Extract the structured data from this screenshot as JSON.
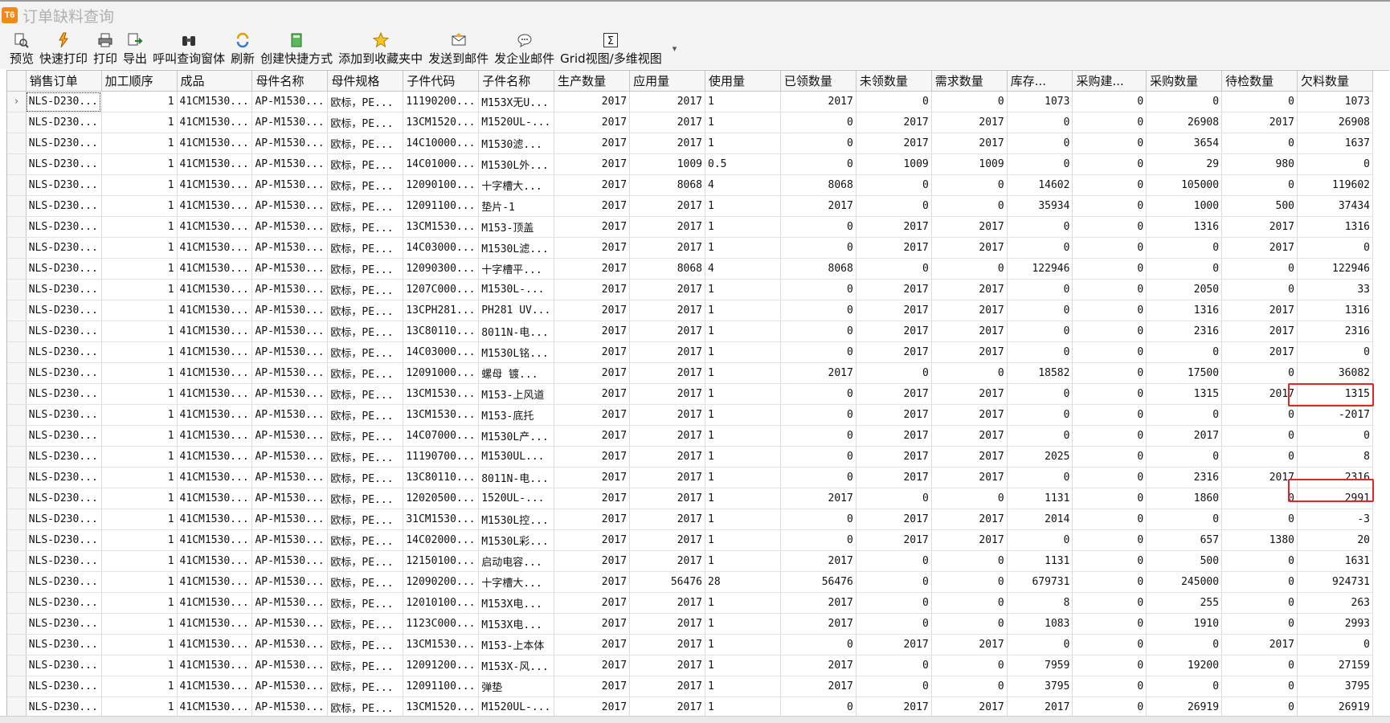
{
  "window": {
    "title": "订单缺料查询",
    "logo_text": "T6"
  },
  "toolbar": {
    "buttons": [
      {
        "label": "预览",
        "icon": "preview-icon"
      },
      {
        "label": "快速打印",
        "icon": "quick-print-icon"
      },
      {
        "label": "打印",
        "icon": "print-icon"
      },
      {
        "label": "导出",
        "icon": "export-icon"
      },
      {
        "label": "呼叫查询窗体",
        "icon": "binoculars-icon"
      },
      {
        "label": "刷新",
        "icon": "refresh-icon"
      },
      {
        "label": "创建快捷方式",
        "icon": "shortcut-icon"
      },
      {
        "label": "添加到收藏夹中",
        "icon": "star-icon"
      },
      {
        "label": "发送到邮件",
        "icon": "mail-icon"
      },
      {
        "label": "发企业邮件",
        "icon": "chat-icon"
      },
      {
        "label": "Grid视图/多维视图",
        "icon": "sigma-icon"
      }
    ],
    "more": "▾"
  },
  "grid": {
    "row_indicator": "›",
    "columns": [
      "销售订单",
      "加工顺序",
      "成品",
      "母件名称",
      "母件规格",
      "子件代码",
      "子件名称",
      "生产数量",
      "应用量",
      "使用量",
      "已领数量",
      "未领数量",
      "需求数量",
      "库存...",
      "采购建...",
      "采购数量",
      "待检数量",
      "欠料数量"
    ],
    "rows": [
      [
        "NLS-D230...",
        "1",
        "41CM1530...",
        "AP-M1530...",
        "欧标，PE...",
        "11190200...",
        "M153X无U...",
        "2017",
        "2017",
        "1",
        "2017",
        "0",
        "0",
        "1073",
        "0",
        "0",
        "0",
        "1073"
      ],
      [
        "NLS-D230...",
        "1",
        "41CM1530...",
        "AP-M1530...",
        "欧标，PE...",
        "13CM1520...",
        "M1520UL-...",
        "2017",
        "2017",
        "1",
        "0",
        "2017",
        "2017",
        "0",
        "0",
        "26908",
        "2017",
        "26908"
      ],
      [
        "NLS-D230...",
        "1",
        "41CM1530...",
        "AP-M1530...",
        "欧标，PE...",
        "14C10000...",
        "M1530滤...",
        "2017",
        "2017",
        "1",
        "0",
        "2017",
        "2017",
        "0",
        "0",
        "3654",
        "0",
        "1637"
      ],
      [
        "NLS-D230...",
        "1",
        "41CM1530...",
        "AP-M1530...",
        "欧标，PE...",
        "14C01000...",
        "M1530L外...",
        "2017",
        "1009",
        "0.5",
        "0",
        "1009",
        "1009",
        "0",
        "0",
        "29",
        "980",
        "0"
      ],
      [
        "NLS-D230...",
        "1",
        "41CM1530...",
        "AP-M1530...",
        "欧标，PE...",
        "12090100...",
        "十字槽大...",
        "2017",
        "8068",
        "4",
        "8068",
        "0",
        "0",
        "14602",
        "0",
        "105000",
        "0",
        "119602"
      ],
      [
        "NLS-D230...",
        "1",
        "41CM1530...",
        "AP-M1530...",
        "欧标，PE...",
        "12091100...",
        "垫片-1",
        "2017",
        "2017",
        "1",
        "2017",
        "0",
        "0",
        "35934",
        "0",
        "1000",
        "500",
        "37434"
      ],
      [
        "NLS-D230...",
        "1",
        "41CM1530...",
        "AP-M1530...",
        "欧标，PE...",
        "13CM1530...",
        "M153-顶盖",
        "2017",
        "2017",
        "1",
        "0",
        "2017",
        "2017",
        "0",
        "0",
        "1316",
        "2017",
        "1316"
      ],
      [
        "NLS-D230...",
        "1",
        "41CM1530...",
        "AP-M1530...",
        "欧标，PE...",
        "14C03000...",
        "M1530L滤...",
        "2017",
        "2017",
        "1",
        "0",
        "2017",
        "2017",
        "0",
        "0",
        "0",
        "2017",
        "0"
      ],
      [
        "NLS-D230...",
        "1",
        "41CM1530...",
        "AP-M1530...",
        "欧标，PE...",
        "12090300...",
        "十字槽平...",
        "2017",
        "8068",
        "4",
        "8068",
        "0",
        "0",
        "122946",
        "0",
        "0",
        "0",
        "122946"
      ],
      [
        "NLS-D230...",
        "1",
        "41CM1530...",
        "AP-M1530...",
        "欧标，PE...",
        "1207C000...",
        "M1530L-...",
        "2017",
        "2017",
        "1",
        "0",
        "2017",
        "2017",
        "0",
        "0",
        "2050",
        "0",
        "33"
      ],
      [
        "NLS-D230...",
        "1",
        "41CM1530...",
        "AP-M1530...",
        "欧标，PE...",
        "13CPH281...",
        "PH281 UV...",
        "2017",
        "2017",
        "1",
        "0",
        "2017",
        "2017",
        "0",
        "0",
        "1316",
        "2017",
        "1316"
      ],
      [
        "NLS-D230...",
        "1",
        "41CM1530...",
        "AP-M1530...",
        "欧标，PE...",
        "13C80110...",
        "8011N-电...",
        "2017",
        "2017",
        "1",
        "0",
        "2017",
        "2017",
        "0",
        "0",
        "2316",
        "2017",
        "2316"
      ],
      [
        "NLS-D230...",
        "1",
        "41CM1530...",
        "AP-M1530...",
        "欧标，PE...",
        "14C03000...",
        "M1530L铭...",
        "2017",
        "2017",
        "1",
        "0",
        "2017",
        "2017",
        "0",
        "0",
        "0",
        "2017",
        "0"
      ],
      [
        "NLS-D230...",
        "1",
        "41CM1530...",
        "AP-M1530...",
        "欧标，PE...",
        "12091000...",
        "螺母 镀...",
        "2017",
        "2017",
        "1",
        "2017",
        "0",
        "0",
        "18582",
        "0",
        "17500",
        "0",
        "36082"
      ],
      [
        "NLS-D230...",
        "1",
        "41CM1530...",
        "AP-M1530...",
        "欧标，PE...",
        "13CM1530...",
        "M153-上风道",
        "2017",
        "2017",
        "1",
        "0",
        "2017",
        "2017",
        "0",
        "0",
        "1315",
        "2017",
        "1315"
      ],
      [
        "NLS-D230...",
        "1",
        "41CM1530...",
        "AP-M1530...",
        "欧标，PE...",
        "13CM1530...",
        "M153-底托",
        "2017",
        "2017",
        "1",
        "0",
        "2017",
        "2017",
        "0",
        "0",
        "0",
        "0",
        "-2017"
      ],
      [
        "NLS-D230...",
        "1",
        "41CM1530...",
        "AP-M1530...",
        "欧标，PE...",
        "14C07000...",
        "M1530L产...",
        "2017",
        "2017",
        "1",
        "0",
        "2017",
        "2017",
        "0",
        "0",
        "2017",
        "0",
        "0"
      ],
      [
        "NLS-D230...",
        "1",
        "41CM1530...",
        "AP-M1530...",
        "欧标，PE...",
        "11190700...",
        "M1530UL...",
        "2017",
        "2017",
        "1",
        "0",
        "2017",
        "2017",
        "2025",
        "0",
        "0",
        "0",
        "8"
      ],
      [
        "NLS-D230...",
        "1",
        "41CM1530...",
        "AP-M1530...",
        "欧标，PE...",
        "13C80110...",
        "8011N-电...",
        "2017",
        "2017",
        "1",
        "0",
        "2017",
        "2017",
        "0",
        "0",
        "2316",
        "2017",
        "2316"
      ],
      [
        "NLS-D230...",
        "1",
        "41CM1530...",
        "AP-M1530...",
        "欧标，PE...",
        "12020500...",
        "1520UL-...",
        "2017",
        "2017",
        "1",
        "2017",
        "0",
        "0",
        "1131",
        "0",
        "1860",
        "0",
        "2991"
      ],
      [
        "NLS-D230...",
        "1",
        "41CM1530...",
        "AP-M1530...",
        "欧标，PE...",
        "31CM1530...",
        "M1530L控...",
        "2017",
        "2017",
        "1",
        "0",
        "2017",
        "2017",
        "2014",
        "0",
        "0",
        "0",
        "-3"
      ],
      [
        "NLS-D230...",
        "1",
        "41CM1530...",
        "AP-M1530...",
        "欧标，PE...",
        "14C02000...",
        "M1530L彩...",
        "2017",
        "2017",
        "1",
        "0",
        "2017",
        "2017",
        "0",
        "0",
        "657",
        "1380",
        "20"
      ],
      [
        "NLS-D230...",
        "1",
        "41CM1530...",
        "AP-M1530...",
        "欧标，PE...",
        "12150100...",
        "启动电容...",
        "2017",
        "2017",
        "1",
        "2017",
        "0",
        "0",
        "1131",
        "0",
        "500",
        "0",
        "1631"
      ],
      [
        "NLS-D230...",
        "1",
        "41CM1530...",
        "AP-M1530...",
        "欧标，PE...",
        "12090200...",
        "十字槽大...",
        "2017",
        "56476",
        "28",
        "56476",
        "0",
        "0",
        "679731",
        "0",
        "245000",
        "0",
        "924731"
      ],
      [
        "NLS-D230...",
        "1",
        "41CM1530...",
        "AP-M1530...",
        "欧标，PE...",
        "12010100...",
        "M153X电...",
        "2017",
        "2017",
        "1",
        "2017",
        "0",
        "0",
        "8",
        "0",
        "255",
        "0",
        "263"
      ],
      [
        "NLS-D230...",
        "1",
        "41CM1530...",
        "AP-M1530...",
        "欧标，PE...",
        "1123C000...",
        "M153X电...",
        "2017",
        "2017",
        "1",
        "2017",
        "0",
        "0",
        "1083",
        "0",
        "1910",
        "0",
        "2993"
      ],
      [
        "NLS-D230...",
        "1",
        "41CM1530...",
        "AP-M1530...",
        "欧标，PE...",
        "13CM1530...",
        "M153-上本体",
        "2017",
        "2017",
        "1",
        "0",
        "2017",
        "2017",
        "0",
        "0",
        "0",
        "2017",
        "0"
      ],
      [
        "NLS-D230...",
        "1",
        "41CM1530...",
        "AP-M1530...",
        "欧标，PE...",
        "12091200...",
        "M153X-风...",
        "2017",
        "2017",
        "1",
        "2017",
        "0",
        "0",
        "7959",
        "0",
        "19200",
        "0",
        "27159"
      ],
      [
        "NLS-D230...",
        "1",
        "41CM1530...",
        "AP-M1530...",
        "欧标，PE...",
        "12091100...",
        "弹垫",
        "2017",
        "2017",
        "1",
        "2017",
        "0",
        "0",
        "3795",
        "0",
        "0",
        "0",
        "3795"
      ],
      [
        "NLS-D230...",
        "1",
        "41CM1530...",
        "AP-M1530...",
        "欧标，PE...",
        "13CM1520...",
        "M1520UL-...",
        "2017",
        "2017",
        "1",
        "0",
        "2017",
        "2017",
        "2017",
        "0",
        "26919",
        "0",
        "26919"
      ]
    ]
  },
  "annotations": {
    "highlight_color": "#e52525"
  }
}
